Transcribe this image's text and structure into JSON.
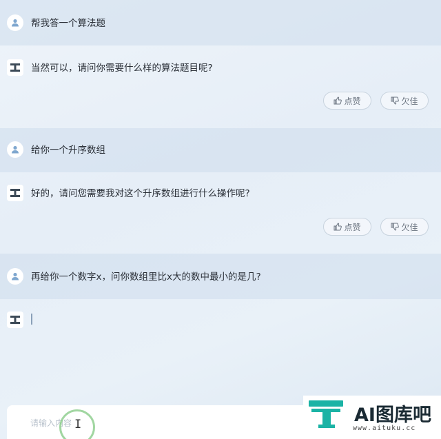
{
  "conversation": {
    "messages": [
      {
        "role": "user",
        "text": "帮我答一个算法题"
      },
      {
        "role": "bot",
        "text": "当然可以，请问你需要什么样的算法题目呢?"
      },
      {
        "role": "user",
        "text": "给你一个升序数组"
      },
      {
        "role": "bot",
        "text": "好的，请问您需要我对这个升序数组进行什么操作呢?"
      },
      {
        "role": "user",
        "text": "再给你一个数字x，问你数组里比x大的数中最小的是几?"
      },
      {
        "role": "bot",
        "text": ""
      }
    ],
    "feedback": {
      "like_label": "点赞",
      "dislike_label": "欠佳"
    }
  },
  "input": {
    "placeholder": "请输入内容",
    "value": ""
  },
  "logo": {
    "brand": "AI图库吧",
    "url": "www.aituku.cc",
    "accent_color": "#1bb3a5"
  },
  "colors": {
    "user_row_bg": "#cddcec",
    "avatar_icon": "#7fa7cf"
  }
}
